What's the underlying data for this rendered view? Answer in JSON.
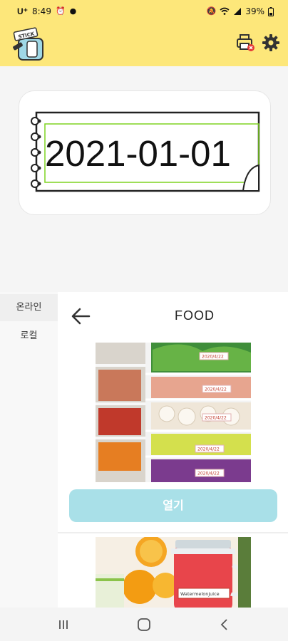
{
  "status_bar": {
    "carrier": "U⁺",
    "time": "8:49",
    "battery": "39%"
  },
  "header": {
    "logo_text": "STICK"
  },
  "preview": {
    "label_text": "2021-01-01"
  },
  "sheet": {
    "tabs": [
      {
        "label": "온라인",
        "active": true
      },
      {
        "label": "로컬",
        "active": false
      }
    ],
    "category_title": "FOOD",
    "open_button_label": "열기",
    "photo1": {
      "tags": [
        "2020/4/22",
        "2020/4/22",
        "2020/4/22",
        "2020/4/22",
        "2020/4/22"
      ]
    },
    "photo2": {
      "jar_label": "Watermelonjuice"
    }
  },
  "colors": {
    "header_bg": "#fde77a",
    "open_button": "#a9e0e8",
    "frame_green": "#7ed321"
  }
}
